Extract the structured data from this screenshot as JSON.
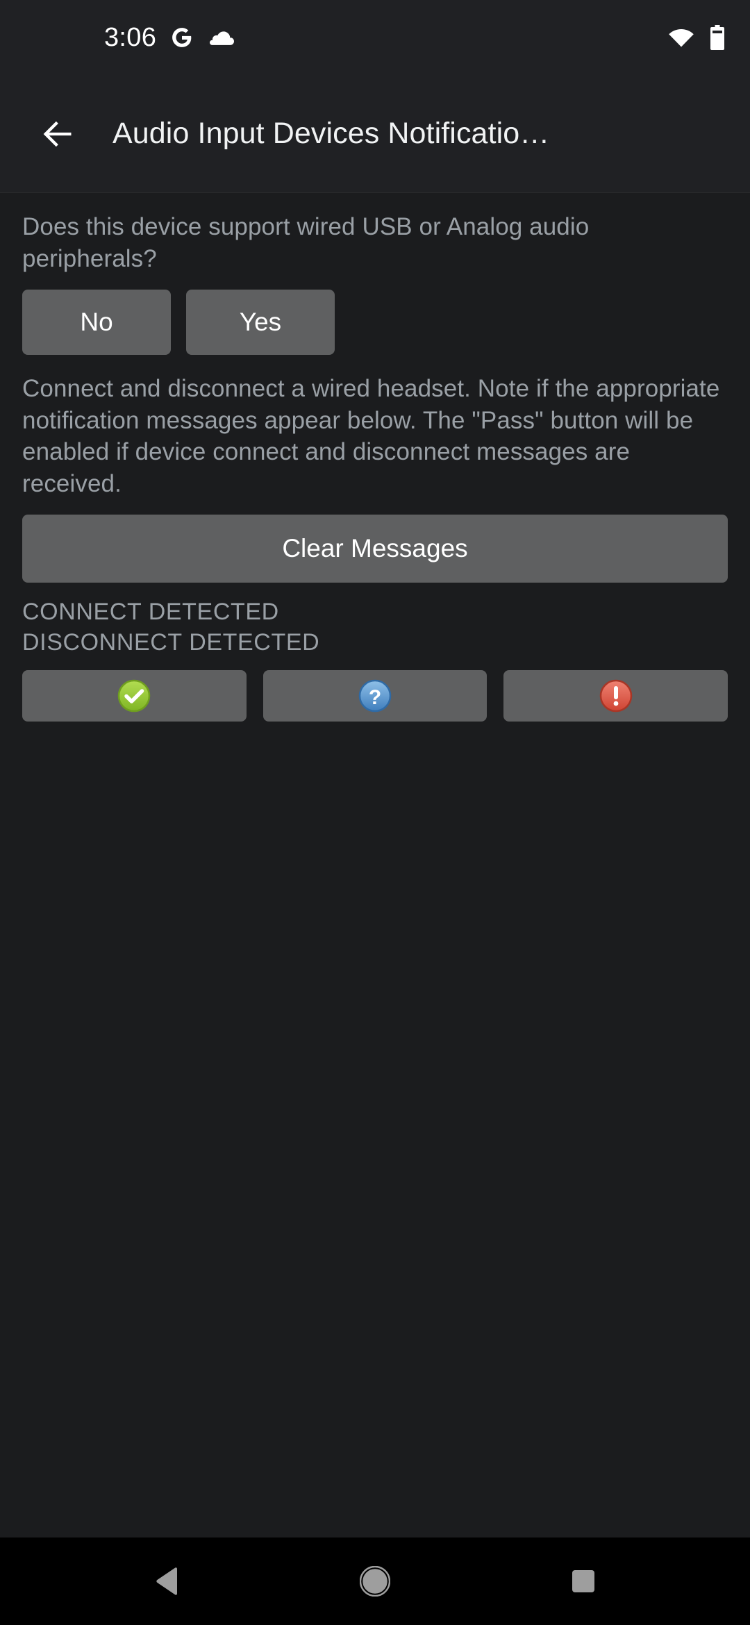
{
  "status_bar": {
    "clock": "3:06",
    "left_icons": [
      "google-g-icon",
      "cloud-icon"
    ],
    "right_icons": [
      "wifi-icon",
      "battery-icon"
    ]
  },
  "app_bar": {
    "back_icon": "back-arrow-icon",
    "title": "Audio Input Devices Notificatio…"
  },
  "content": {
    "question": "Does this device support wired USB or Analog audio peripherals?",
    "answer_buttons": [
      {
        "label": "No",
        "name": "no-button"
      },
      {
        "label": "Yes",
        "name": "yes-button"
      }
    ],
    "instruction": "Connect and disconnect a wired headset. Note if the appropriate notification messages appear below. The \"Pass\" button will be enabled if device connect and disconnect messages are received.",
    "clear_button_label": "Clear Messages",
    "status_messages": [
      "CONNECT DETECTED",
      "DISCONNECT DETECTED"
    ],
    "verdict_buttons": [
      {
        "name": "pass-button",
        "icon": "check-circle-icon",
        "color": "#9acd32"
      },
      {
        "name": "info-button",
        "icon": "question-circle-icon",
        "color": "#5b9bd5"
      },
      {
        "name": "fail-button",
        "icon": "exclamation-circle-icon",
        "color": "#e05a4a"
      }
    ]
  },
  "nav_bar": {
    "back": "nav-back-icon",
    "home": "nav-home-icon",
    "recents": "nav-recents-icon"
  },
  "colors": {
    "background": "#1b1c1e",
    "app_bar": "#202124",
    "button": "#5f6061",
    "text_primary": "#f1f3f4",
    "text_secondary": "#9aa0a6",
    "nav_bar": "#000000",
    "nav_icon": "#9e9e9e"
  }
}
